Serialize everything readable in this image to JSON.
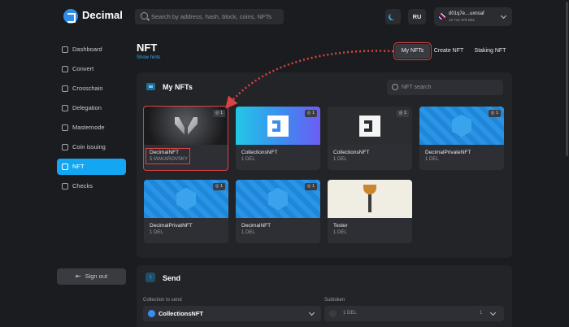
{
  "app": {
    "name": "Decimal"
  },
  "header": {
    "search_placeholder": "Search by address, hash, block, coins, NFTs",
    "lang": "RU",
    "account_address": "d01q7e…uxnsaf",
    "account_balance": "10 712 378 DEL"
  },
  "sidebar": {
    "items": [
      {
        "label": "Dashboard",
        "icon": "home-icon"
      },
      {
        "label": "Convert",
        "icon": "convert-icon"
      },
      {
        "label": "Crosschain",
        "icon": "crosschain-icon"
      },
      {
        "label": "Delegation",
        "icon": "delegation-icon"
      },
      {
        "label": "Masternode",
        "icon": "masternode-icon"
      },
      {
        "label": "Coin issuing",
        "icon": "coin-icon"
      },
      {
        "label": "NFT",
        "icon": "nft-icon",
        "active": true
      },
      {
        "label": "Checks",
        "icon": "checks-icon"
      }
    ],
    "sign_out": "Sign out"
  },
  "page": {
    "title": "NFT",
    "hints": "Show hints",
    "tabs": [
      "My NFTs",
      "Create NFT",
      "Staking NFT"
    ]
  },
  "panel": {
    "title": "My NFTs",
    "search_placeholder": "NFT search",
    "cards": [
      {
        "name": "DecimalNFT",
        "sub": "5 MAKAROVSKY",
        "badge": "1"
      },
      {
        "name": "CollectionsNFT",
        "sub": "1 DEL",
        "badge": "1"
      },
      {
        "name": "CollectionsNFT",
        "sub": "1 DEL",
        "badge": "1"
      },
      {
        "name": "DecimalPrivateNFT",
        "sub": "1 DEL",
        "badge": "1"
      },
      {
        "name": "DecimalPrivatNFT",
        "sub": "1 DEL",
        "badge": "1"
      },
      {
        "name": "DecimalNFT",
        "sub": "1 DEL",
        "badge": "1"
      },
      {
        "name": "Tester",
        "sub": "1 DEL",
        "badge": ""
      }
    ]
  },
  "send": {
    "title": "Send",
    "collection_label": "Collection to send",
    "collection_value": "CollectionsNFT",
    "subtoken_label": "Subtoken",
    "subtoken_value": "1 DEL",
    "subtoken_count": "1"
  },
  "colors": {
    "accent": "#13a6f2",
    "highlight": "#d94343"
  }
}
